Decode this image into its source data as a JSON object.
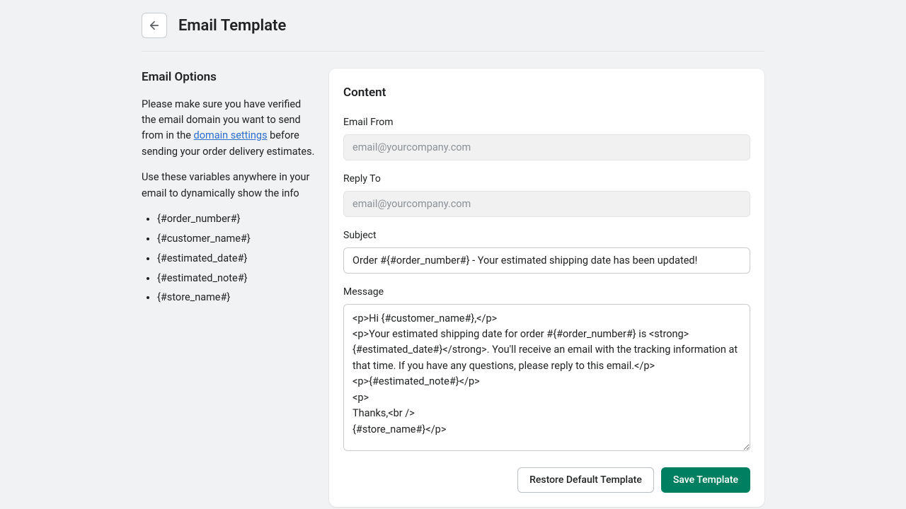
{
  "header": {
    "title": "Email Template"
  },
  "sidebar": {
    "heading": "Email Options",
    "desc_part1": "Please make sure you have verified the email domain you want to send from in the ",
    "desc_link": "domain settings",
    "desc_part2": " before sending your order delivery estimates.",
    "desc_vars": "Use these variables anywhere in your email to dynamically show the info",
    "variables": [
      "{#order_number#}",
      "{#customer_name#}",
      "{#estimated_date#}",
      "{#estimated_note#}",
      "{#store_name#}"
    ]
  },
  "content": {
    "heading": "Content",
    "email_from_label": "Email From",
    "email_from_placeholder": "email@yourcompany.com",
    "reply_to_label": "Reply To",
    "reply_to_placeholder": "email@yourcompany.com",
    "subject_label": "Subject",
    "subject_value": "Order #{#order_number#} - Your estimated shipping date has been updated!",
    "message_label": "Message",
    "message_value": "<p>Hi {#customer_name#},</p>\n<p>Your estimated shipping date for order #{#order_number#} is <strong>{#estimated_date#}</strong>. You'll receive an email with the tracking information at that time. If you have any questions, please reply to this email.</p>\n<p>{#estimated_note#}</p>\n<p>\nThanks,<br />\n{#store_name#}</p>"
  },
  "actions": {
    "restore": "Restore Default Template",
    "save": "Save Template"
  }
}
